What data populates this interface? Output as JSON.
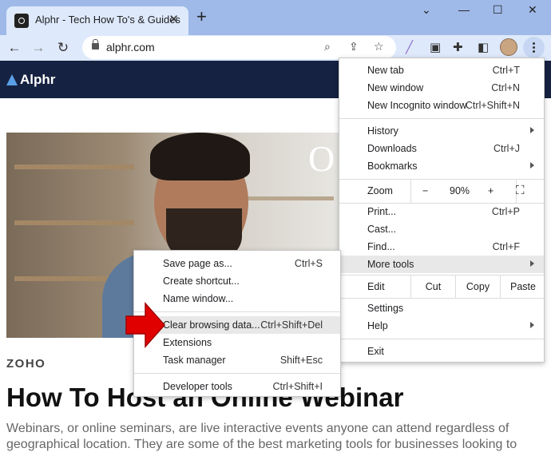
{
  "browser": {
    "tab_title": "Alphr - Tech How To's & Guides",
    "tab_close": "✕",
    "new_tab_symbol": "+",
    "window_controls": {
      "menu_chevron": "⌄",
      "minimize": "—",
      "maximize": "☐",
      "close": "✕"
    },
    "url": "alphr.com",
    "nav": {
      "back": "←",
      "forward": "→",
      "reload": "↻"
    },
    "icons": [
      "zoom-icon",
      "share-icon",
      "star-icon",
      "pen-extension-icon",
      "screenshot-extension-icon",
      "puzzle-extensions-icon",
      "side-panel-icon",
      "profile-avatar",
      "kebab-menu-icon"
    ]
  },
  "site": {
    "logo": "Alphr",
    "hero_overlay_text": "O",
    "category": "ZOHO",
    "headline": "How To Host an Online Webinar",
    "body": "Webinars, or online seminars, are live interactive events anyone can attend regardless of geographical location. They are some of the best marketing tools for businesses looking to"
  },
  "main_menu": {
    "new_tab": {
      "label": "New tab",
      "shortcut": "Ctrl+T"
    },
    "new_window": {
      "label": "New window",
      "shortcut": "Ctrl+N"
    },
    "new_incognito": {
      "label": "New Incognito window",
      "shortcut": "Ctrl+Shift+N"
    },
    "history": {
      "label": "History"
    },
    "downloads": {
      "label": "Downloads",
      "shortcut": "Ctrl+J"
    },
    "bookmarks": {
      "label": "Bookmarks"
    },
    "zoom": {
      "label": "Zoom",
      "minus": "−",
      "level": "90%",
      "plus": "+"
    },
    "print": {
      "label": "Print...",
      "shortcut": "Ctrl+P"
    },
    "cast": {
      "label": "Cast..."
    },
    "find": {
      "label": "Find...",
      "shortcut": "Ctrl+F"
    },
    "more_tools": {
      "label": "More tools"
    },
    "edit": {
      "label": "Edit",
      "cut": "Cut",
      "copy": "Copy",
      "paste": "Paste"
    },
    "settings": {
      "label": "Settings"
    },
    "help": {
      "label": "Help"
    },
    "exit": {
      "label": "Exit"
    }
  },
  "more_tools_menu": {
    "save_page": {
      "label": "Save page as...",
      "shortcut": "Ctrl+S"
    },
    "create_shortcut": {
      "label": "Create shortcut..."
    },
    "name_window": {
      "label": "Name window..."
    },
    "clear_browsing": {
      "label": "Clear browsing data...",
      "shortcut": "Ctrl+Shift+Del"
    },
    "extensions": {
      "label": "Extensions"
    },
    "task_manager": {
      "label": "Task manager",
      "shortcut": "Shift+Esc"
    },
    "developer_tools": {
      "label": "Developer tools",
      "shortcut": "Ctrl+Shift+I"
    }
  },
  "colors": {
    "titlebar": "#9fb9e8",
    "toolbar": "#dee9fb",
    "site_header": "#162241",
    "arrow_red": "#e00000",
    "highlight": "#e8e8e8"
  }
}
